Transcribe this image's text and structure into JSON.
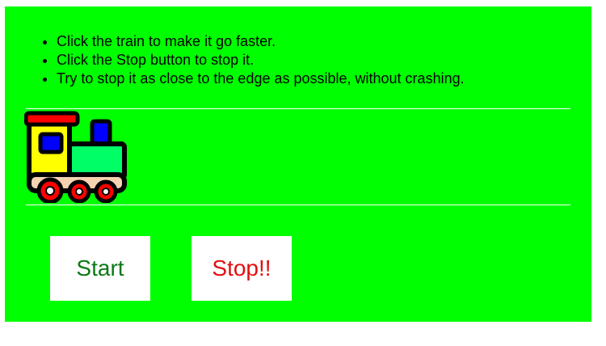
{
  "instructions": [
    "Click the train to make it go faster.",
    "Click the Stop button to stop it.",
    "Try to stop it as close to the edge as possible, without crashing."
  ],
  "buttons": {
    "start_label": "Start",
    "stop_label": "Stop!!"
  },
  "icons": {
    "train": "toy-train-icon"
  },
  "colors": {
    "background": "#00ff00",
    "track_line": "#ffffff",
    "start_text": "#0b7a16",
    "stop_text": "#e01010"
  }
}
